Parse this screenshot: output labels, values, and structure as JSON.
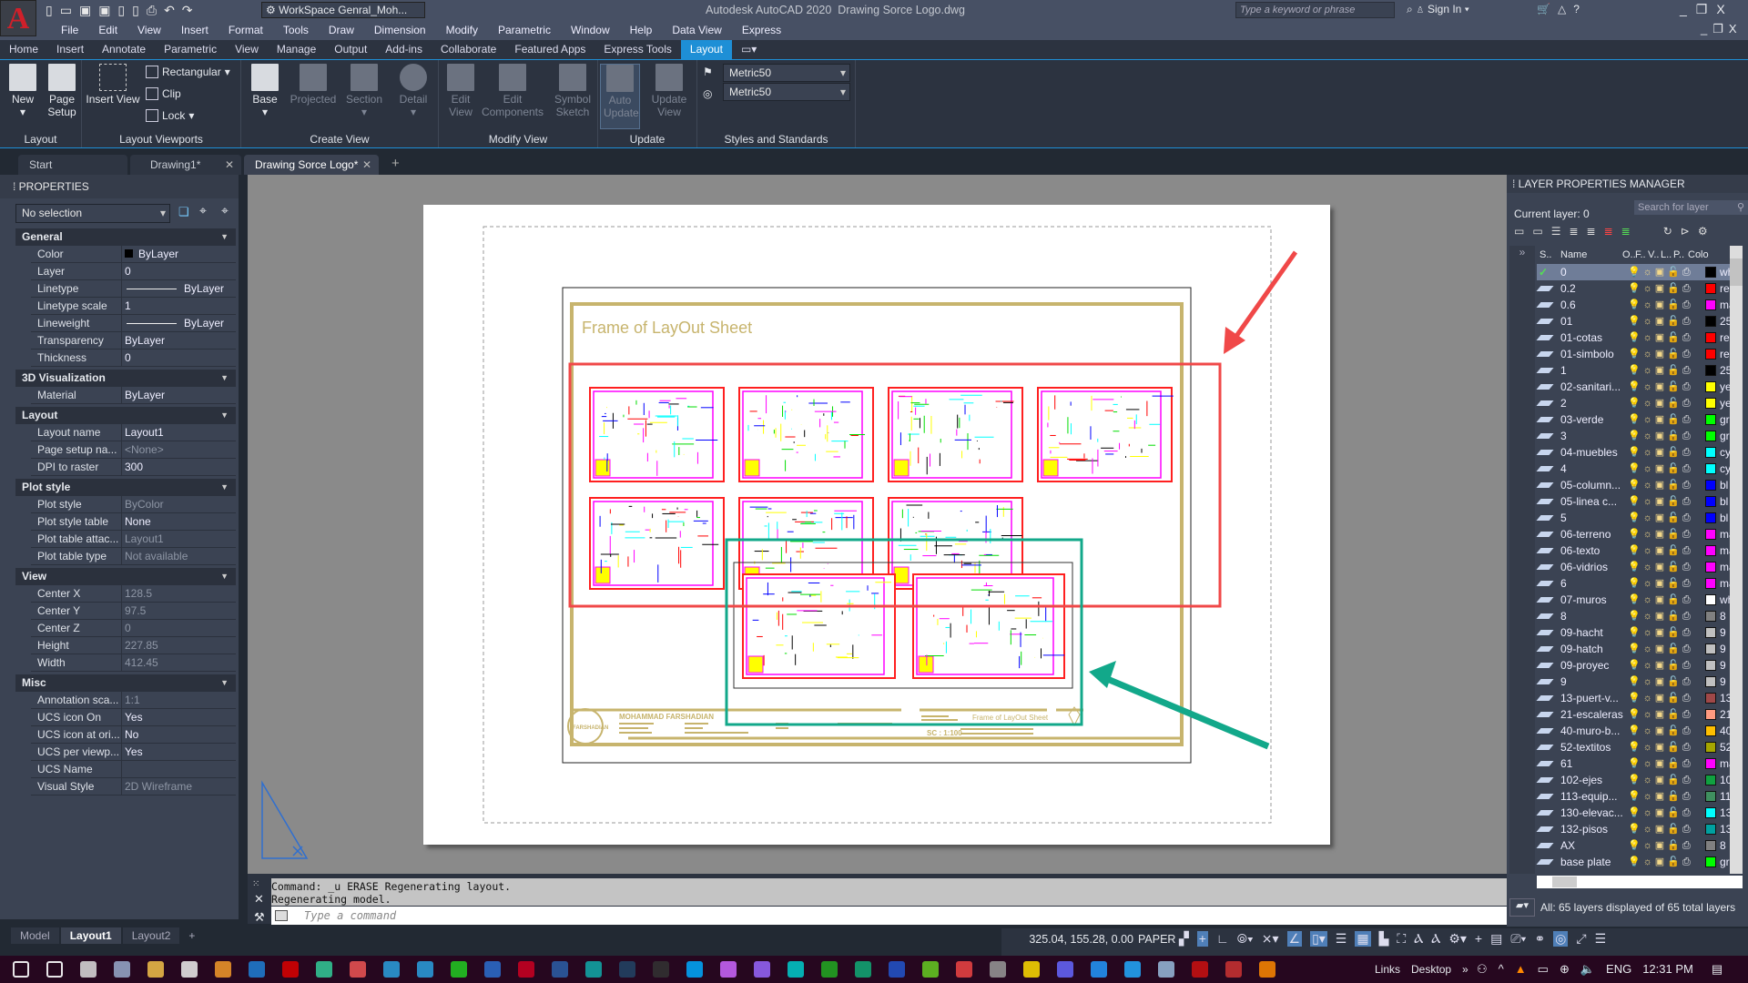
{
  "titlebar": {
    "workspace": "WorkSpace Genral_Moh...",
    "app_title": "Autodesk AutoCAD 2020",
    "file_title": "Drawing Sorce Logo.dwg",
    "search_placeholder": "Type a keyword or phrase",
    "sign_in": "Sign In"
  },
  "menu": [
    "File",
    "Edit",
    "View",
    "Insert",
    "Format",
    "Tools",
    "Draw",
    "Dimension",
    "Modify",
    "Parametric",
    "Window",
    "Help",
    "Data View",
    "Express"
  ],
  "ribbon_tabs": [
    "Home",
    "Insert",
    "Annotate",
    "Parametric",
    "View",
    "Manage",
    "Output",
    "Add-ins",
    "Collaborate",
    "Featured Apps",
    "Express Tools",
    "Layout"
  ],
  "active_ribbon_tab": "Layout",
  "ribbon": {
    "layout": {
      "title": "Layout",
      "new": "New",
      "page_setup": "Page Setup"
    },
    "viewports": {
      "title": "Layout Viewports",
      "insert_view": "Insert View",
      "rectangular": "Rectangular",
      "clip": "Clip",
      "lock": "Lock"
    },
    "create_view": {
      "title": "Create View",
      "base": "Base",
      "projected": "Projected",
      "section": "Section",
      "detail": "Detail"
    },
    "modify_view": {
      "title": "Modify View",
      "edit_view": "Edit View",
      "edit_components": "Edit Components",
      "symbol_sketch": "Symbol Sketch"
    },
    "update": {
      "title": "Update",
      "auto_update": "Auto Update",
      "update_view": "Update View"
    },
    "styles": {
      "title": "Styles and Standards",
      "style1": "Metric50",
      "style2": "Metric50"
    }
  },
  "doc_tabs": [
    {
      "label": "Start"
    },
    {
      "label": "Drawing1*"
    },
    {
      "label": "Drawing Sorce Logo*",
      "active": true
    }
  ],
  "properties": {
    "title": "PROPERTIES",
    "selection": "No selection",
    "sections": [
      {
        "name": "General",
        "rows": [
          [
            "Color",
            "ByLayer"
          ],
          [
            "Layer",
            "0"
          ],
          [
            "Linetype",
            "ByLayer"
          ],
          [
            "Linetype scale",
            "1"
          ],
          [
            "Lineweight",
            "ByLayer"
          ],
          [
            "Transparency",
            "ByLayer"
          ],
          [
            "Thickness",
            "0"
          ]
        ]
      },
      {
        "name": "3D Visualization",
        "rows": [
          [
            "Material",
            "ByLayer"
          ]
        ]
      },
      {
        "name": "Layout",
        "rows": [
          [
            "Layout name",
            "Layout1"
          ],
          [
            "Page setup na...",
            "<None>"
          ],
          [
            "DPI to raster",
            "300"
          ]
        ]
      },
      {
        "name": "Plot style",
        "rows": [
          [
            "Plot style",
            "ByColor"
          ],
          [
            "Plot style table",
            "None"
          ],
          [
            "Plot table attac...",
            "Layout1"
          ],
          [
            "Plot table type",
            "Not available"
          ]
        ]
      },
      {
        "name": "View",
        "rows": [
          [
            "Center X",
            "128.5"
          ],
          [
            "Center Y",
            "97.5"
          ],
          [
            "Center Z",
            "0"
          ],
          [
            "Height",
            "227.85"
          ],
          [
            "Width",
            "412.45"
          ]
        ]
      },
      {
        "name": "Misc",
        "rows": [
          [
            "Annotation sca...",
            "1:1"
          ],
          [
            "UCS icon On",
            "Yes"
          ],
          [
            "UCS icon at ori...",
            "No"
          ],
          [
            "UCS per viewp...",
            "Yes"
          ],
          [
            "UCS Name",
            ""
          ],
          [
            "Visual Style",
            "2D Wireframe"
          ]
        ]
      }
    ]
  },
  "drawing": {
    "sheet_title": "Frame of LayOut Sheet",
    "author": "MOHAMMAD FARSHADIAN",
    "logo_text": "FARSHADIAN",
    "block_title": "Frame of LayOut Sheet",
    "scale": "SC : 1:100",
    "highlight_red": "#f04848",
    "highlight_green": "#12a88a"
  },
  "command": {
    "history": [
      "Command: _u ERASE Regenerating layout.",
      "Regenerating model."
    ],
    "placeholder": "Type a command"
  },
  "layout_tabs": [
    "Model",
    "Layout1",
    "Layout2"
  ],
  "active_layout_tab": "Layout1",
  "layers": {
    "title": "LAYER PROPERTIES MANAGER",
    "current": "Current layer: 0",
    "search_placeholder": "Search for layer",
    "columns": [
      "S..",
      "Name",
      "O..",
      "F..",
      "V..",
      "L..",
      "P..",
      "Colo"
    ],
    "rows": [
      {
        "name": "0",
        "color": "#000000",
        "cname": "wh",
        "current": true
      },
      {
        "name": "0.2",
        "color": "#ff0000",
        "cname": "re"
      },
      {
        "name": "0.6",
        "color": "#ff00ff",
        "cname": "ma"
      },
      {
        "name": "01",
        "color": "#000000",
        "cname": "25"
      },
      {
        "name": "01-cotas",
        "color": "#ff0000",
        "cname": "re"
      },
      {
        "name": "01-simbolo",
        "color": "#ff0000",
        "cname": "re"
      },
      {
        "name": "1",
        "color": "#000000",
        "cname": "25"
      },
      {
        "name": "02-sanitari...",
        "color": "#ffff00",
        "cname": "ye"
      },
      {
        "name": "2",
        "color": "#ffff00",
        "cname": "ye"
      },
      {
        "name": "03-verde",
        "color": "#00ff00",
        "cname": "gr"
      },
      {
        "name": "3",
        "color": "#00ff00",
        "cname": "gr"
      },
      {
        "name": "04-muebles",
        "color": "#00ffff",
        "cname": "cy"
      },
      {
        "name": "4",
        "color": "#00ffff",
        "cname": "cy"
      },
      {
        "name": "05-column...",
        "color": "#0000ff",
        "cname": "bl"
      },
      {
        "name": "05-linea c...",
        "color": "#0000ff",
        "cname": "bl"
      },
      {
        "name": "5",
        "color": "#0000ff",
        "cname": "bl"
      },
      {
        "name": "06-terreno",
        "color": "#ff00ff",
        "cname": "ma"
      },
      {
        "name": "06-texto",
        "color": "#ff00ff",
        "cname": "ma"
      },
      {
        "name": "06-vidrios",
        "color": "#ff00ff",
        "cname": "ma"
      },
      {
        "name": "6",
        "color": "#ff00ff",
        "cname": "ma"
      },
      {
        "name": "07-muros",
        "color": "#ffffff",
        "cname": "wh"
      },
      {
        "name": "8",
        "color": "#808080",
        "cname": "8"
      },
      {
        "name": "09-hacht",
        "color": "#c0c0c0",
        "cname": "9"
      },
      {
        "name": "09-hatch",
        "color": "#c0c0c0",
        "cname": "9"
      },
      {
        "name": "09-proyec",
        "color": "#c0c0c0",
        "cname": "9"
      },
      {
        "name": "9",
        "color": "#c0c0c0",
        "cname": "9"
      },
      {
        "name": "13-puert-v...",
        "color": "#a04848",
        "cname": "13"
      },
      {
        "name": "21-escaleras",
        "color": "#ff9a80",
        "cname": "21"
      },
      {
        "name": "40-muro-b...",
        "color": "#ffbf00",
        "cname": "40"
      },
      {
        "name": "52-textitos",
        "color": "#a5a500",
        "cname": "52"
      },
      {
        "name": "61",
        "color": "#ff00ff",
        "cname": "ma"
      },
      {
        "name": "102-ejes",
        "color": "#10a040",
        "cname": "10"
      },
      {
        "name": "113-equip...",
        "color": "#3f8f5f",
        "cname": "11"
      },
      {
        "name": "130-elevac...",
        "color": "#00ffff",
        "cname": "13"
      },
      {
        "name": "132-pisos",
        "color": "#00a0a0",
        "cname": "13"
      },
      {
        "name": "AX",
        "color": "#808080",
        "cname": "8"
      },
      {
        "name": "base plate",
        "color": "#00ff00",
        "cname": "gr"
      }
    ],
    "footer": "All: 65 layers displayed of 65 total layers"
  },
  "status": {
    "coords": "325.04, 155.28, 0.00",
    "space": "PAPER"
  },
  "taskbar": {
    "links": "Links",
    "desktop": "Desktop",
    "lang": "ENG",
    "time": "12:31 PM"
  }
}
